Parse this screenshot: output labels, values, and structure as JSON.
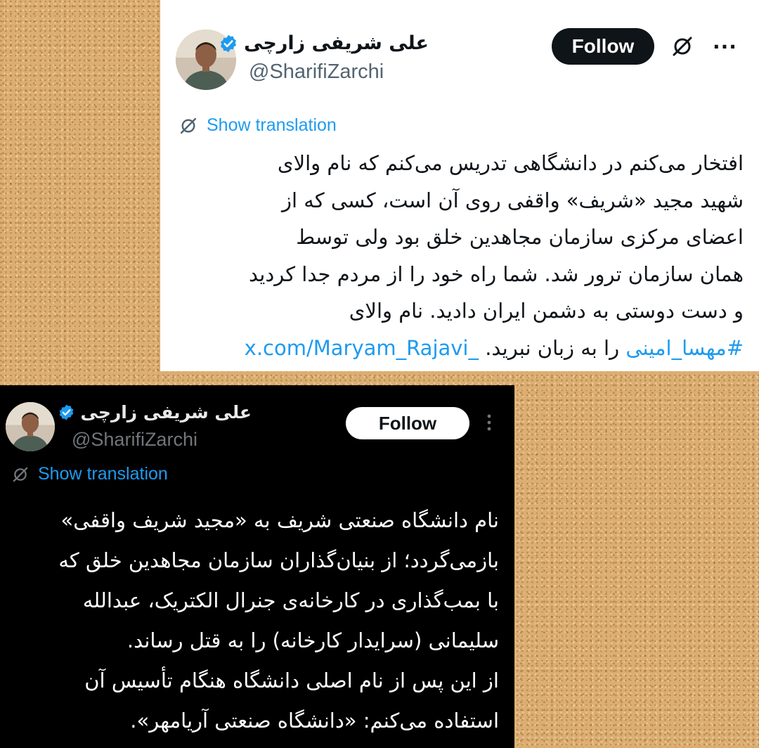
{
  "top_tweet": {
    "author_name": "علی شریفی زارچی",
    "handle": "@SharifiZarchi",
    "follow_label": "Follow",
    "more_label": "···",
    "translate_label": "Show translation",
    "lines": [
      "افتخار می‌کنم در دانشگاهی تدریس می‌کنم که نام والای",
      "شهید مجید «شریف» واقفی روی آن است، کسی که از",
      "اعضای مرکزی سازمان مجاهدین خلق بود ولی توسط",
      "همان سازمان ترور شد. شما راه خود را از مردم جدا کردید",
      "و دست دوستی به دشمن ایران دادید. نام والای"
    ],
    "hashtag": "#مهسا_امینی",
    "last_line_text": " را به زبان نبرید. ",
    "link_text": "x.com/Maryam_Rajavi_"
  },
  "bottom_tweet": {
    "author_name": "علی شریفی زارچی",
    "handle": "@SharifiZarchi",
    "follow_label": "Follow",
    "translate_label": "Show translation",
    "lines": [
      "نام دانشگاه صنعتی شریف به «مجید شریف واقفی»",
      "بازمی‌گردد؛ از بنیان‌گذاران سازمان مجاهدین خلق که",
      "با بمب‌گذاری در کارخانه‌ی جنرال الکتریک، عبدالله",
      "سلیمانی (سرایدار کارخانه) را به قتل رساند.",
      "از این پس از نام اصلی دانشگاه هنگام تأسیس آن",
      "استفاده می‌کنم: «دانشگاه صنعتی آریامهر»."
    ]
  },
  "colors": {
    "accent_blue": "#1d9bf0",
    "verified_badge": "#1d9bf0",
    "background_cork": "#dcae72"
  },
  "icons": [
    "verified-badge-icon",
    "grok-translate-icon",
    "more-options-icon",
    "avatar"
  ]
}
